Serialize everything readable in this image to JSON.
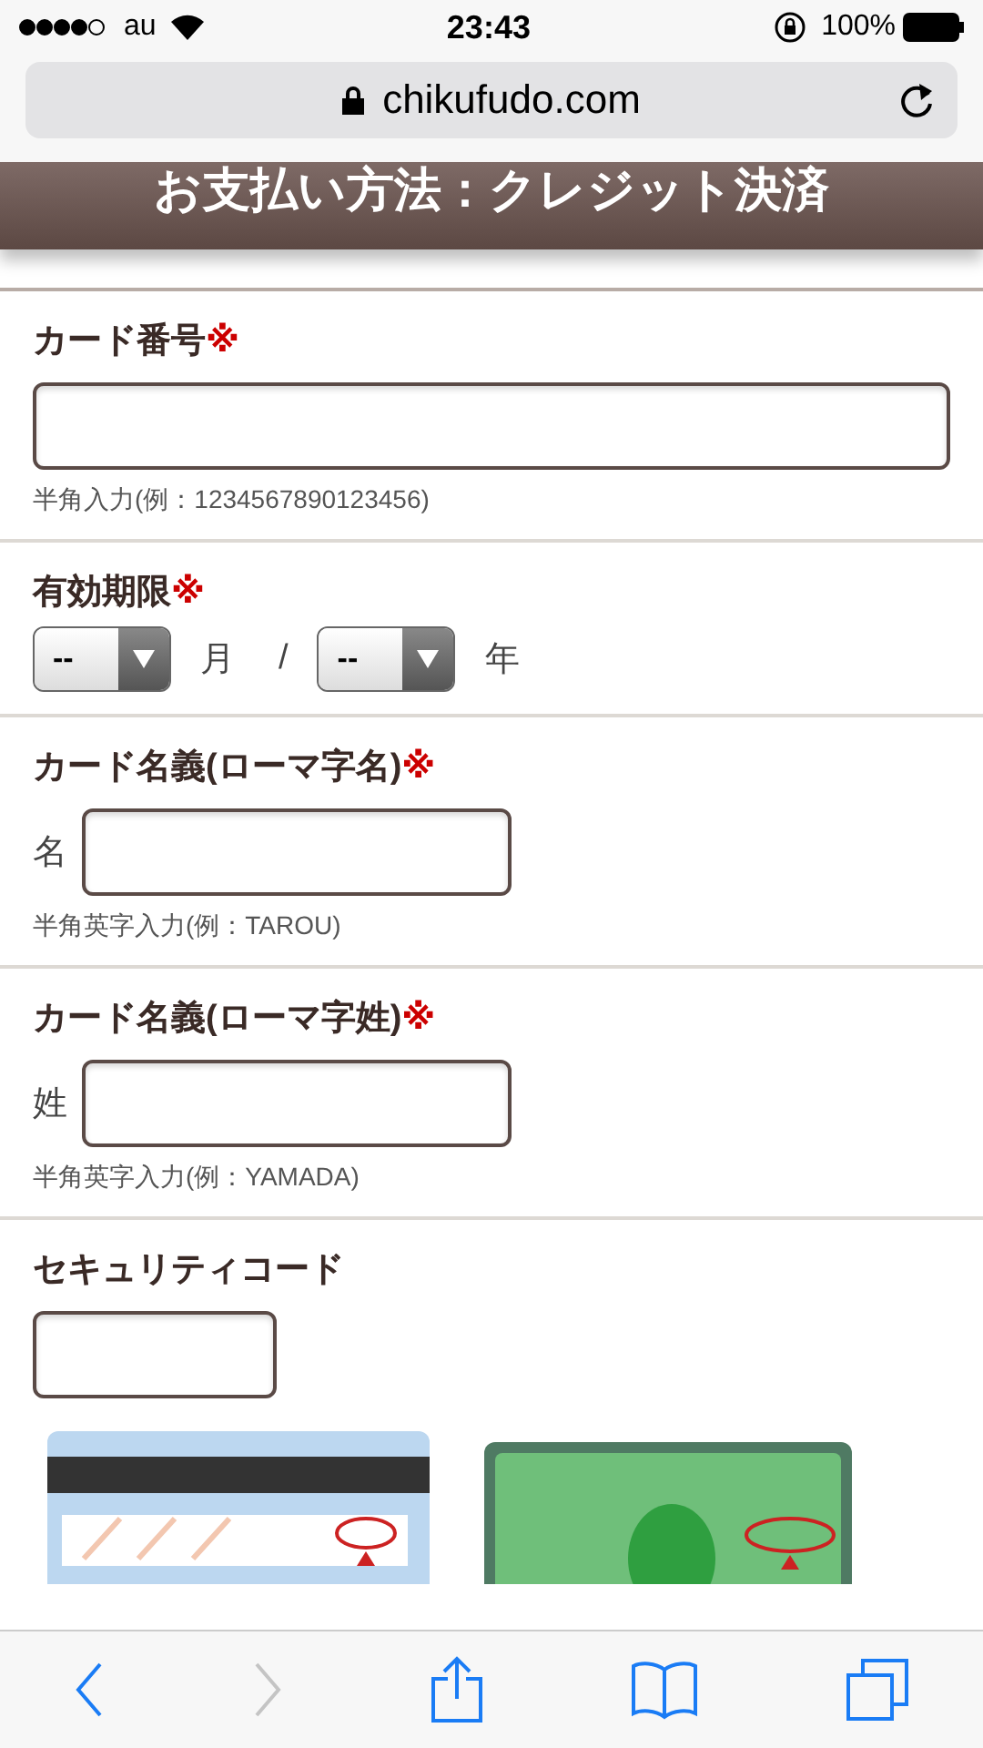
{
  "status_bar": {
    "carrier": "au",
    "time": "23:43",
    "battery": "100%"
  },
  "address_bar": {
    "url": "chikufudo.com"
  },
  "page_title": "お支払い方法：クレジット決済",
  "fields": [
    {
      "kind": "text",
      "label": "カード番号",
      "required_mark": "※",
      "hint": "半角入力(例：1234567890123456)"
    },
    {
      "kind": "expiry",
      "label": "有効期限",
      "required_mark": "※",
      "parts": [
        {
          "kind": "select",
          "value": "--"
        },
        {
          "kind": "text",
          "text": "月"
        },
        {
          "kind": "text",
          "text": "/"
        },
        {
          "kind": "select",
          "value": "--"
        },
        {
          "kind": "text",
          "text": "年"
        }
      ]
    },
    {
      "kind": "prefixed",
      "label": "カード名義(ローマ字名)",
      "required_mark": "※",
      "prefix": "名",
      "hint": "半角英字入力(例：TAROU)"
    },
    {
      "kind": "prefixed",
      "label": "カード名義(ローマ字姓)",
      "required_mark": "※",
      "prefix": "姓",
      "hint": "半角英字入力(例：YAMADA)"
    },
    {
      "kind": "short",
      "label": "セキュリティコード"
    }
  ],
  "toolbar": [
    {
      "kind": "back",
      "disabled": false
    },
    {
      "kind": "forward",
      "disabled": true
    },
    {
      "kind": "share",
      "disabled": false
    },
    {
      "kind": "bookmarks",
      "disabled": false
    },
    {
      "kind": "tabs",
      "disabled": false
    }
  ]
}
